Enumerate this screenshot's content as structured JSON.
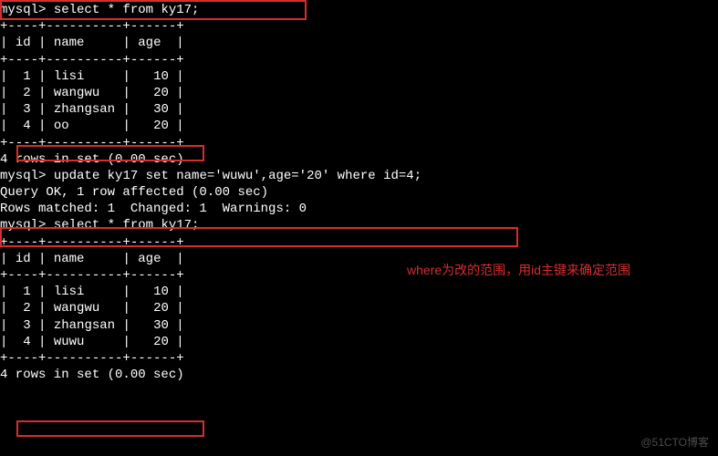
{
  "prompt": "mysql>",
  "queries": {
    "select1": "select * from ky17;",
    "update": "update ky17 set name='wuwu',age='20' where id=4;",
    "select2": "select * from ky17;"
  },
  "table1": {
    "headers": {
      "id": "id",
      "name": "name",
      "age": "age"
    },
    "rows": [
      {
        "id": "1",
        "name": "lisi",
        "age": "10"
      },
      {
        "id": "2",
        "name": "wangwu",
        "age": "20"
      },
      {
        "id": "3",
        "name": "zhangsan",
        "age": "30"
      },
      {
        "id": "4",
        "name": "oo",
        "age": "20"
      }
    ],
    "footer": "4 rows in set (0.00 sec)"
  },
  "update_result": {
    "l1": "Query OK, 1 row affected (0.00 sec)",
    "l2": "Rows matched: 1  Changed: 1  Warnings: 0"
  },
  "table2": {
    "headers": {
      "id": "id",
      "name": "name",
      "age": "age"
    },
    "rows": [
      {
        "id": "1",
        "name": "lisi",
        "age": "10"
      },
      {
        "id": "2",
        "name": "wangwu",
        "age": "20"
      },
      {
        "id": "3",
        "name": "zhangsan",
        "age": "30"
      },
      {
        "id": "4",
        "name": "wuwu",
        "age": "20"
      }
    ],
    "footer": "4 rows in set (0.00 sec)"
  },
  "annotation": "where为改的范围，用id主键来确定范围",
  "watermark": "@51CTO博客",
  "sep": {
    "border": "+----+----------+------+",
    "blank": ""
  }
}
